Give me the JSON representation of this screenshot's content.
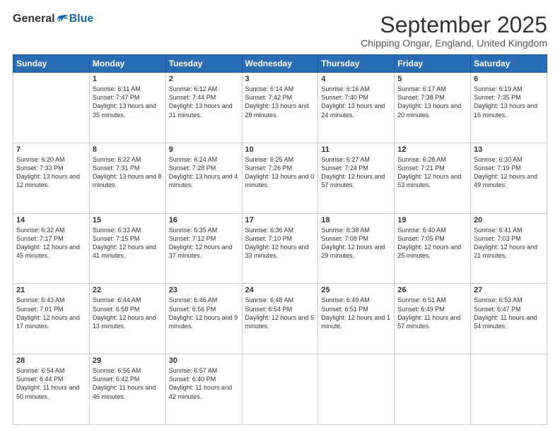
{
  "logo": {
    "general": "General",
    "blue": "Blue"
  },
  "header": {
    "month": "September 2025",
    "location": "Chipping Ongar, England, United Kingdom"
  },
  "weekdays": [
    "Sunday",
    "Monday",
    "Tuesday",
    "Wednesday",
    "Thursday",
    "Friday",
    "Saturday"
  ],
  "weeks": [
    [
      {
        "day": "",
        "sunrise": "",
        "sunset": "",
        "daylight": ""
      },
      {
        "day": "1",
        "sunrise": "Sunrise: 6:11 AM",
        "sunset": "Sunset: 7:47 PM",
        "daylight": "Daylight: 13 hours and 35 minutes."
      },
      {
        "day": "2",
        "sunrise": "Sunrise: 6:12 AM",
        "sunset": "Sunset: 7:44 PM",
        "daylight": "Daylight: 13 hours and 31 minutes."
      },
      {
        "day": "3",
        "sunrise": "Sunrise: 6:14 AM",
        "sunset": "Sunset: 7:42 PM",
        "daylight": "Daylight: 13 hours and 28 minutes."
      },
      {
        "day": "4",
        "sunrise": "Sunrise: 6:16 AM",
        "sunset": "Sunset: 7:40 PM",
        "daylight": "Daylight: 13 hours and 24 minutes."
      },
      {
        "day": "5",
        "sunrise": "Sunrise: 6:17 AM",
        "sunset": "Sunset: 7:38 PM",
        "daylight": "Daylight: 13 hours and 20 minutes."
      },
      {
        "day": "6",
        "sunrise": "Sunrise: 6:19 AM",
        "sunset": "Sunset: 7:35 PM",
        "daylight": "Daylight: 13 hours and 16 minutes."
      }
    ],
    [
      {
        "day": "7",
        "sunrise": "Sunrise: 6:20 AM",
        "sunset": "Sunset: 7:33 PM",
        "daylight": "Daylight: 13 hours and 12 minutes."
      },
      {
        "day": "8",
        "sunrise": "Sunrise: 6:22 AM",
        "sunset": "Sunset: 7:31 PM",
        "daylight": "Daylight: 13 hours and 8 minutes."
      },
      {
        "day": "9",
        "sunrise": "Sunrise: 6:24 AM",
        "sunset": "Sunset: 7:28 PM",
        "daylight": "Daylight: 13 hours and 4 minutes."
      },
      {
        "day": "10",
        "sunrise": "Sunrise: 6:25 AM",
        "sunset": "Sunset: 7:26 PM",
        "daylight": "Daylight: 13 hours and 0 minutes."
      },
      {
        "day": "11",
        "sunrise": "Sunrise: 6:27 AM",
        "sunset": "Sunset: 7:24 PM",
        "daylight": "Daylight: 12 hours and 57 minutes."
      },
      {
        "day": "12",
        "sunrise": "Sunrise: 6:28 AM",
        "sunset": "Sunset: 7:21 PM",
        "daylight": "Daylight: 12 hours and 53 minutes."
      },
      {
        "day": "13",
        "sunrise": "Sunrise: 6:30 AM",
        "sunset": "Sunset: 7:19 PM",
        "daylight": "Daylight: 12 hours and 49 minutes."
      }
    ],
    [
      {
        "day": "14",
        "sunrise": "Sunrise: 6:32 AM",
        "sunset": "Sunset: 7:17 PM",
        "daylight": "Daylight: 12 hours and 45 minutes."
      },
      {
        "day": "15",
        "sunrise": "Sunrise: 6:33 AM",
        "sunset": "Sunset: 7:15 PM",
        "daylight": "Daylight: 12 hours and 41 minutes."
      },
      {
        "day": "16",
        "sunrise": "Sunrise: 6:35 AM",
        "sunset": "Sunset: 7:12 PM",
        "daylight": "Daylight: 12 hours and 37 minutes."
      },
      {
        "day": "17",
        "sunrise": "Sunrise: 6:36 AM",
        "sunset": "Sunset: 7:10 PM",
        "daylight": "Daylight: 12 hours and 33 minutes."
      },
      {
        "day": "18",
        "sunrise": "Sunrise: 6:38 AM",
        "sunset": "Sunset: 7:08 PM",
        "daylight": "Daylight: 12 hours and 29 minutes."
      },
      {
        "day": "19",
        "sunrise": "Sunrise: 6:40 AM",
        "sunset": "Sunset: 7:05 PM",
        "daylight": "Daylight: 12 hours and 25 minutes."
      },
      {
        "day": "20",
        "sunrise": "Sunrise: 6:41 AM",
        "sunset": "Sunset: 7:03 PM",
        "daylight": "Daylight: 12 hours and 21 minutes."
      }
    ],
    [
      {
        "day": "21",
        "sunrise": "Sunrise: 6:43 AM",
        "sunset": "Sunset: 7:01 PM",
        "daylight": "Daylight: 12 hours and 17 minutes."
      },
      {
        "day": "22",
        "sunrise": "Sunrise: 6:44 AM",
        "sunset": "Sunset: 6:58 PM",
        "daylight": "Daylight: 12 hours and 13 minutes."
      },
      {
        "day": "23",
        "sunrise": "Sunrise: 6:46 AM",
        "sunset": "Sunset: 6:56 PM",
        "daylight": "Daylight: 12 hours and 9 minutes."
      },
      {
        "day": "24",
        "sunrise": "Sunrise: 6:48 AM",
        "sunset": "Sunset: 6:54 PM",
        "daylight": "Daylight: 12 hours and 5 minutes."
      },
      {
        "day": "25",
        "sunrise": "Sunrise: 6:49 AM",
        "sunset": "Sunset: 6:51 PM",
        "daylight": "Daylight: 12 hours and 1 minute."
      },
      {
        "day": "26",
        "sunrise": "Sunrise: 6:51 AM",
        "sunset": "Sunset: 6:49 PM",
        "daylight": "Daylight: 11 hours and 57 minutes."
      },
      {
        "day": "27",
        "sunrise": "Sunrise: 6:53 AM",
        "sunset": "Sunset: 6:47 PM",
        "daylight": "Daylight: 11 hours and 54 minutes."
      }
    ],
    [
      {
        "day": "28",
        "sunrise": "Sunrise: 6:54 AM",
        "sunset": "Sunset: 6:44 PM",
        "daylight": "Daylight: 11 hours and 50 minutes."
      },
      {
        "day": "29",
        "sunrise": "Sunrise: 6:56 AM",
        "sunset": "Sunset: 6:42 PM",
        "daylight": "Daylight: 11 hours and 46 minutes."
      },
      {
        "day": "30",
        "sunrise": "Sunrise: 6:57 AM",
        "sunset": "Sunset: 6:40 PM",
        "daylight": "Daylight: 11 hours and 42 minutes."
      },
      {
        "day": "",
        "sunrise": "",
        "sunset": "",
        "daylight": ""
      },
      {
        "day": "",
        "sunrise": "",
        "sunset": "",
        "daylight": ""
      },
      {
        "day": "",
        "sunrise": "",
        "sunset": "",
        "daylight": ""
      },
      {
        "day": "",
        "sunrise": "",
        "sunset": "",
        "daylight": ""
      }
    ]
  ]
}
